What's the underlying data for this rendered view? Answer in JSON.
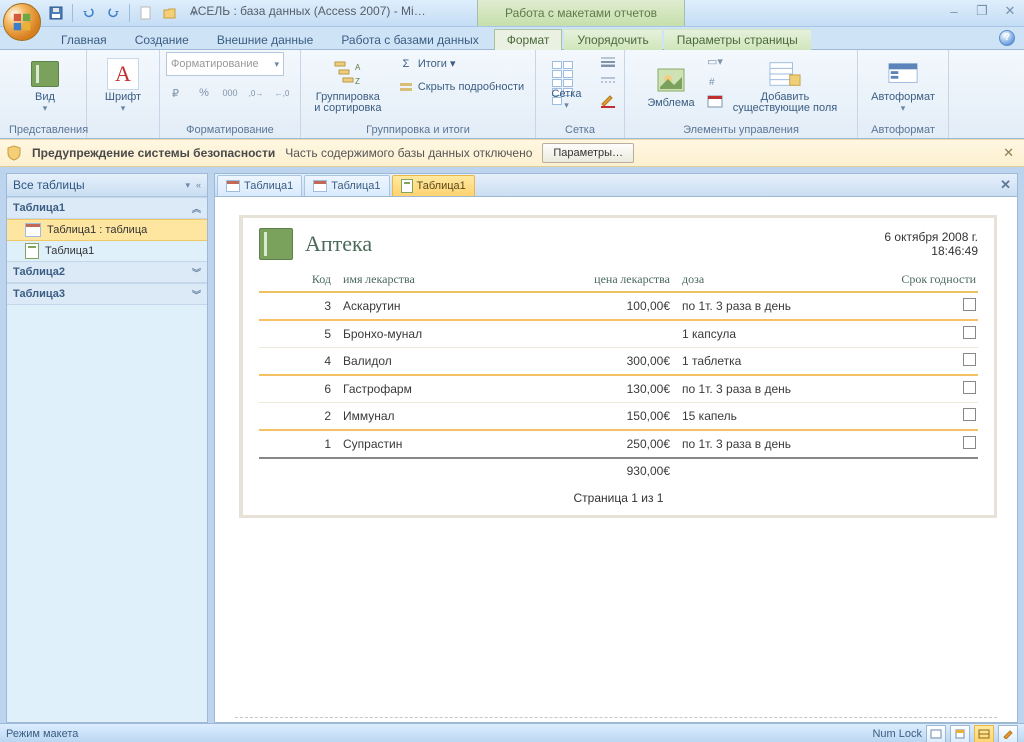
{
  "app": {
    "title": "АСЕЛЬ : база данных (Access 2007) - Mi…",
    "context_tab_title": "Работа с макетами отчетов"
  },
  "window_controls": {
    "minimize": "–",
    "restore": "❐",
    "close": "✕"
  },
  "qat": {
    "save_tip": "save",
    "undo_tip": "undo",
    "redo_tip": "redo",
    "open_tip": "open"
  },
  "ribbon_tabs": {
    "home": "Главная",
    "create": "Создание",
    "external": "Внешние данные",
    "dbtools": "Работа с базами данных",
    "format": "Формат",
    "arrange": "Упорядочить",
    "pagesetup": "Параметры страницы"
  },
  "ribbon": {
    "view": "Вид",
    "views_group": "Представления",
    "font": "Шрифт",
    "formatting_placeholder": "Форматирование",
    "formatting_group": "Форматирование",
    "grouping_sort": "Группировка\nи сортировка",
    "totals": "Итоги ▾",
    "hide_details": "Скрыть подробности",
    "grouping_totals_group": "Группировка и итоги",
    "grid": "Сетка",
    "grid_group": "Сетка",
    "logo": "Эмблема",
    "add_fields": "Добавить\nсуществующие поля",
    "controls_group": "Элементы управления",
    "autoformat": "Автоформат",
    "autoformat_group": "Автоформат"
  },
  "security": {
    "title": "Предупреждение системы безопасности",
    "message": "Часть содержимого базы данных отключено",
    "button": "Параметры…"
  },
  "navpane": {
    "header": "Все таблицы",
    "groups": [
      {
        "title": "Таблица1",
        "expanded": true,
        "items": [
          {
            "label": "Таблица1 : таблица",
            "type": "table",
            "selected": true
          },
          {
            "label": "Таблица1",
            "type": "report",
            "selected": false
          }
        ]
      },
      {
        "title": "Таблица2",
        "expanded": false,
        "items": []
      },
      {
        "title": "Таблица3",
        "expanded": false,
        "items": []
      }
    ]
  },
  "doc_tabs": [
    {
      "label": "Таблица1",
      "type": "table",
      "active": false
    },
    {
      "label": "Таблица1",
      "type": "table",
      "active": false
    },
    {
      "label": "Таблица1",
      "type": "report",
      "active": true
    }
  ],
  "report": {
    "title": "Аптека",
    "date": "6 октября 2008 г.",
    "time": "18:46:49",
    "columns": {
      "code": "Код",
      "name": "имя лекарства",
      "price": "цена лекарства",
      "dose": "доза",
      "expiry": "Срок годности"
    },
    "rows": [
      {
        "code": "3",
        "name": "Аскарутин",
        "price": "100,00€",
        "dose": "по 1т. 3 раза в день"
      },
      {
        "code": "5",
        "name": "Бронхо-мунал",
        "price": "",
        "dose": "1 капсула"
      },
      {
        "code": "4",
        "name": "Валидол",
        "price": "300,00€",
        "dose": "1 таблетка"
      },
      {
        "code": "6",
        "name": "Гастрофарм",
        "price": "130,00€",
        "dose": "по 1т. 3 раза в день"
      },
      {
        "code": "2",
        "name": "Иммунал",
        "price": "150,00€",
        "dose": "15 капель"
      },
      {
        "code": "1",
        "name": "Супрастин",
        "price": "250,00€",
        "dose": "по 1т. 3 раза в день"
      }
    ],
    "total": "930,00€",
    "pager": "Страница 1 из 1"
  },
  "status": {
    "mode": "Режим макета",
    "numlock": "Num Lock"
  }
}
